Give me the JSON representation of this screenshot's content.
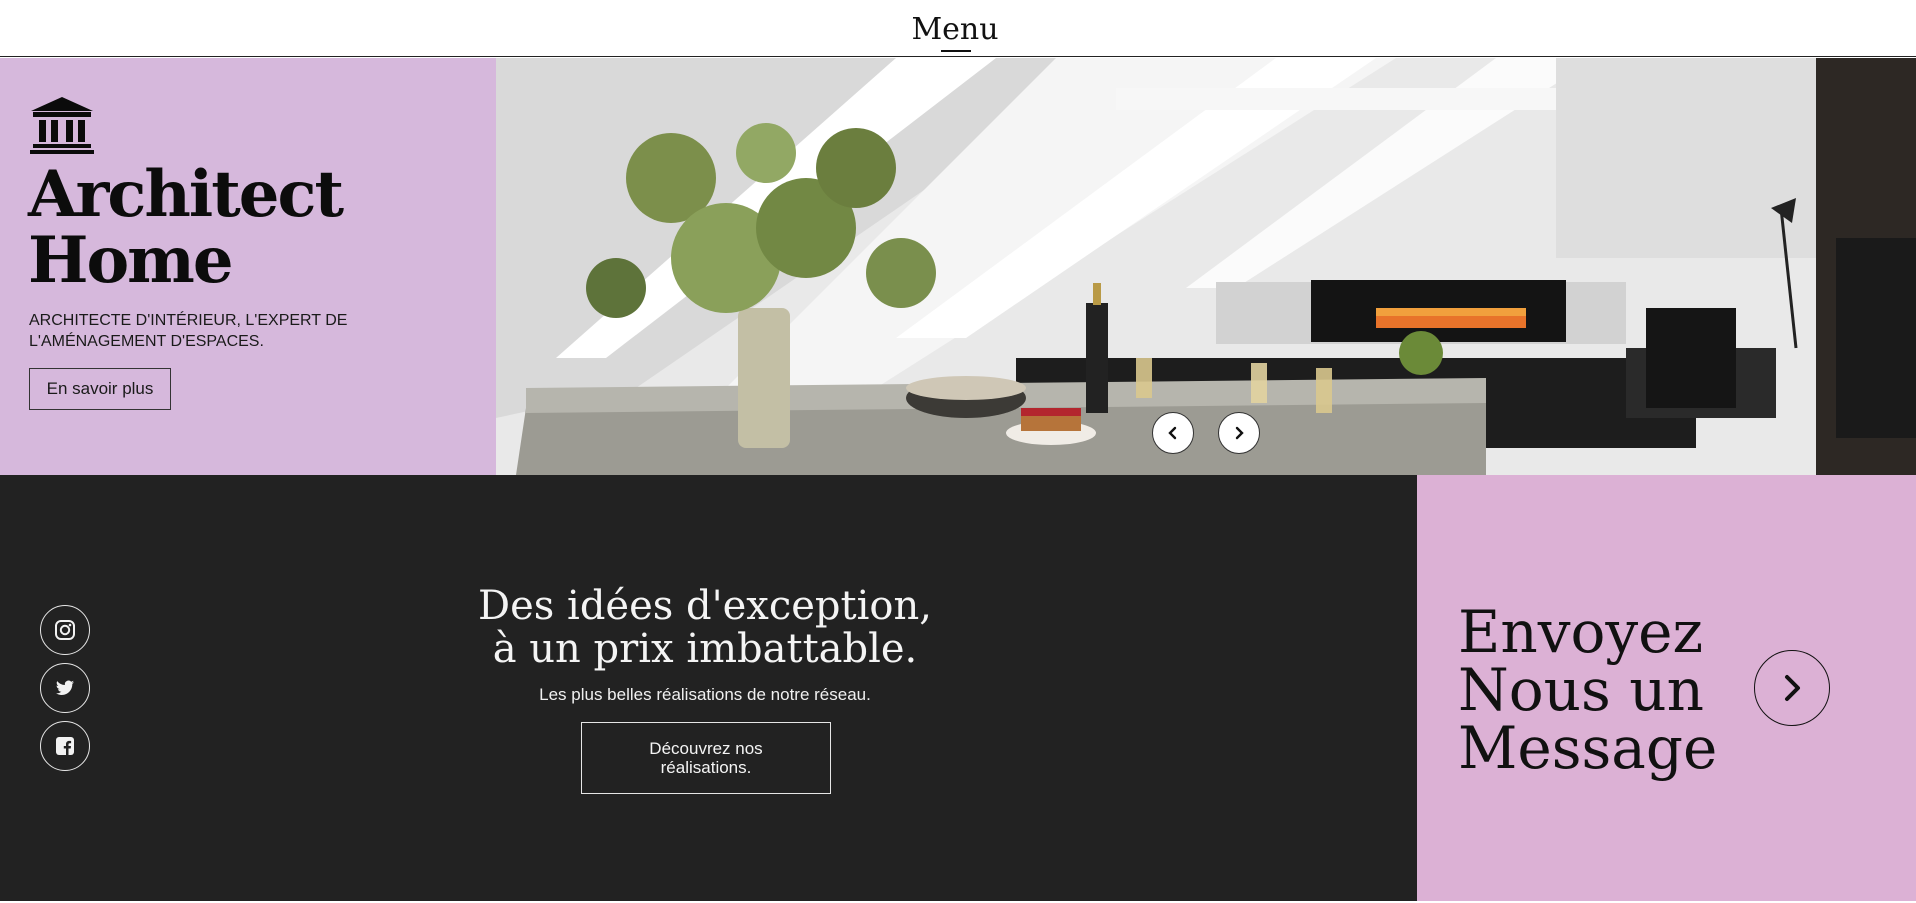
{
  "nav": {
    "menu_label": "Menu"
  },
  "hero": {
    "logo_icon": "classical-building-icon",
    "title_line1": "Architect",
    "title_line2": "Home",
    "subtitle_line1": "ARCHITECTE D'INTÉRIEUR, L'EXPERT DE",
    "subtitle_line2": "L'AMÉNAGEMENT D'ESPACES.",
    "cta_label": "En savoir plus",
    "background_color": "#d6b8dc",
    "image_description_icon": "living-room-photo",
    "carousel_prev_icon": "chevron-left-icon",
    "carousel_next_icon": "chevron-right-icon"
  },
  "promo": {
    "title_line1": "Des idées d'exception,",
    "title_line2": "à un prix imbattable.",
    "subtitle": "Les plus belles réalisations de notre réseau.",
    "cta_label": "Découvrez nos réalisations.",
    "background_color": "#222222"
  },
  "social": {
    "items": [
      {
        "name": "instagram",
        "icon": "instagram-icon"
      },
      {
        "name": "twitter",
        "icon": "twitter-icon"
      },
      {
        "name": "facebook",
        "icon": "facebook-icon"
      }
    ]
  },
  "contact": {
    "title_line1": "Envoyez",
    "title_line2": "Nous un",
    "title_line3": "Message",
    "arrow_icon": "chevron-right-icon",
    "background_color": "#dcb1d5"
  }
}
